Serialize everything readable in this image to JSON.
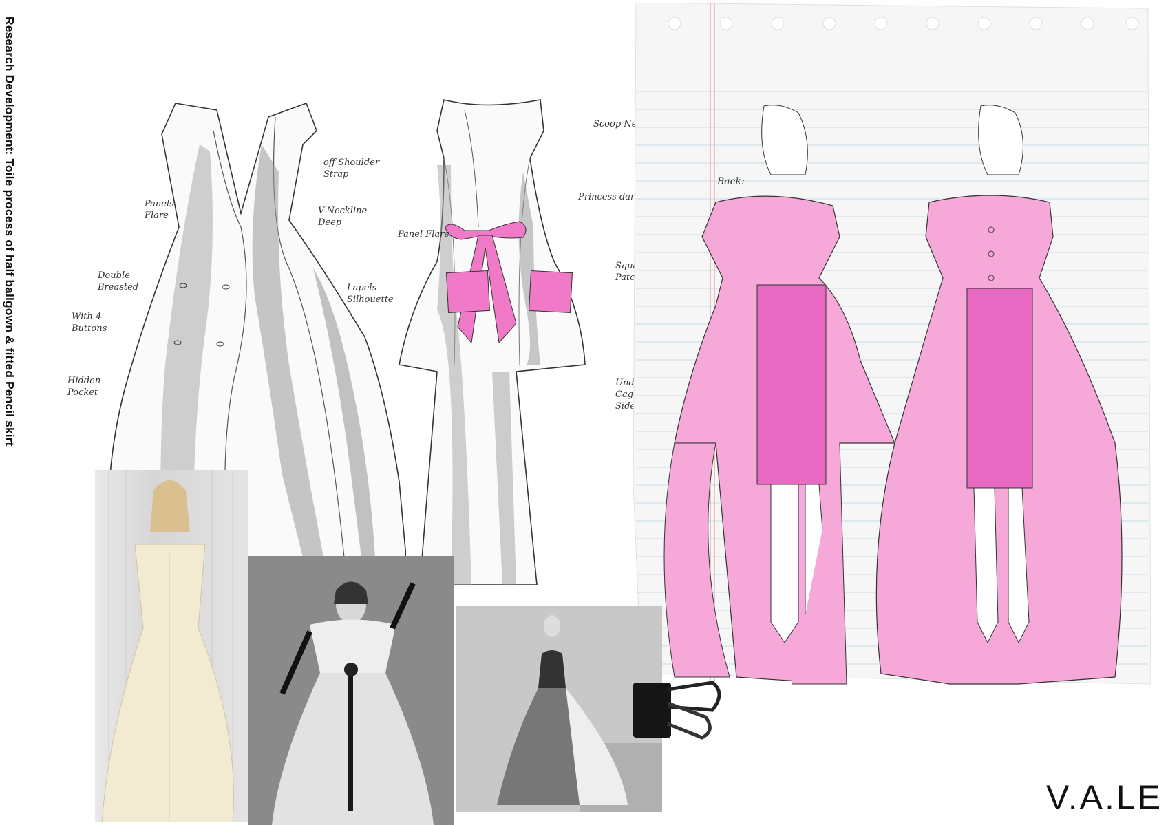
{
  "title": "Research Development: Toile process of half ballgown & fitted Pencil skirt",
  "brand_logo": "V.A.LE",
  "front_sketch_annotations": [
    "off Shoulder\nStrap",
    "Panels\nFlare",
    "V-Neckline\nDeep",
    "Double\nBreasted",
    "With 4\nButtons",
    "Lapels\nSilhouette",
    "Hidden\nPocket"
  ],
  "back_sketch_annotations": [
    "Scoop Neckline",
    "Princess dart line",
    "Panel Flare",
    "Square pocket\nPatch",
    "Under Wear\nCage Skirt\nSide"
  ],
  "notebook_label": "Back:",
  "colors": {
    "accent_pink": "#f07ac8",
    "pink_light": "#f6a8d8",
    "pink_dark": "#e048b0",
    "paper_line": "#cfe1ea",
    "margin_line": "#e6b0b0"
  },
  "icons": [
    "binder-clip-icon"
  ]
}
